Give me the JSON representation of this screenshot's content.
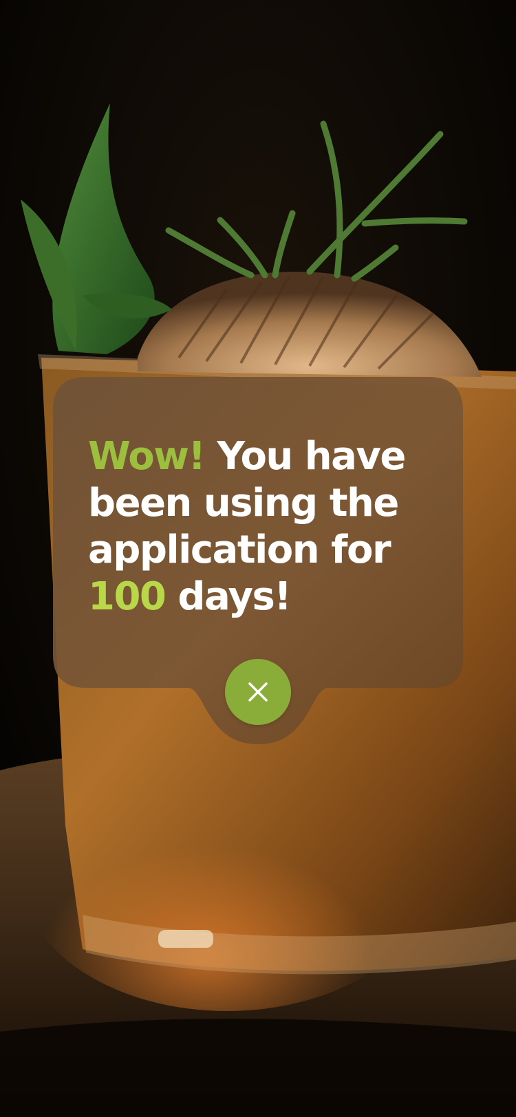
{
  "popup": {
    "message": {
      "highlight_prefix": "Wow!",
      "part_1": " You have been using the application for ",
      "highlight_count": "100",
      "part_2": " days!"
    },
    "close_button": {
      "icon": "close-icon"
    }
  },
  "colors": {
    "accent_green": "#9cc03e",
    "accent_lime": "#b8d84a",
    "button_green": "#8aad3a",
    "popup_brown": "#7a5634"
  }
}
